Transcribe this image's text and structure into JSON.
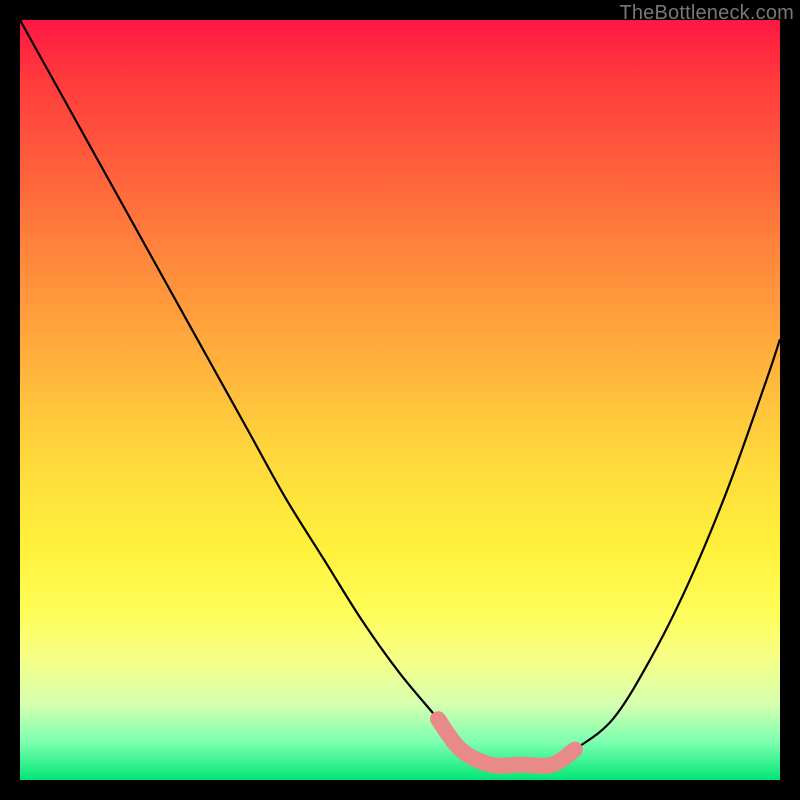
{
  "watermark": "TheBottleneck.com",
  "chart_data": {
    "type": "line",
    "title": "",
    "xlabel": "",
    "ylabel": "",
    "xlim": [
      0,
      100
    ],
    "ylim": [
      0,
      100
    ],
    "grid": false,
    "legend": false,
    "series": [
      {
        "name": "bottleneck-curve",
        "x": [
          0,
          5,
          10,
          15,
          20,
          25,
          30,
          35,
          40,
          45,
          50,
          55,
          58,
          62,
          66,
          70,
          73,
          78,
          83,
          88,
          93,
          98,
          100
        ],
        "y": [
          100,
          91,
          82,
          73,
          64,
          55,
          46,
          37,
          29,
          21,
          14,
          8,
          4,
          2,
          2,
          2,
          4,
          8,
          16,
          26,
          38,
          52,
          58
        ]
      },
      {
        "name": "highlight-band",
        "x": [
          55,
          58,
          62,
          66,
          70,
          73
        ],
        "y": [
          8,
          4,
          2,
          2,
          2,
          4
        ]
      }
    ],
    "colors": {
      "curve": "#000000",
      "highlight": "#e88a8a",
      "gradient_top": "#ff1744",
      "gradient_mid": "#ffe93c",
      "gradient_bottom": "#00e676"
    }
  }
}
